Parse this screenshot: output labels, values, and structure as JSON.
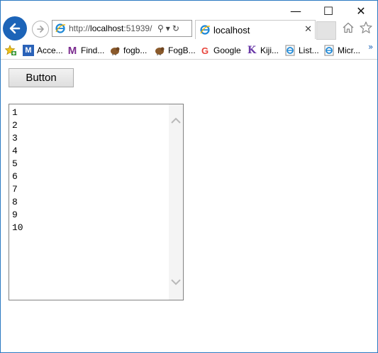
{
  "window": {
    "controls": {
      "minimize": "—",
      "maximize": "☐",
      "close": "✕"
    }
  },
  "navigation": {
    "address": {
      "prefix": "http://",
      "host": "localhost",
      "rest": ":51939/"
    },
    "address_icons": {
      "search": "⚲",
      "dropdown": "▾",
      "refresh": "↻"
    },
    "tab": {
      "title": "localhost",
      "close": "✕"
    }
  },
  "favorites": {
    "items": [
      {
        "label": "Acce...",
        "icon": "M"
      },
      {
        "label": "Find...",
        "icon": "M"
      },
      {
        "label": "fogb...",
        "icon": ""
      },
      {
        "label": "FogB...",
        "icon": ""
      },
      {
        "label": "Google",
        "icon": "G"
      },
      {
        "label": "Kiji...",
        "icon": "K"
      },
      {
        "label": "List...",
        "icon": ""
      },
      {
        "label": "Micr...",
        "icon": ""
      }
    ],
    "more": "»"
  },
  "page": {
    "button_label": "Button",
    "listbox_items": [
      "1",
      "2",
      "3",
      "4",
      "5",
      "6",
      "7",
      "8",
      "9",
      "10"
    ]
  },
  "colors": {
    "accent": "#1c64b8",
    "window_border": "#2b79c2"
  }
}
